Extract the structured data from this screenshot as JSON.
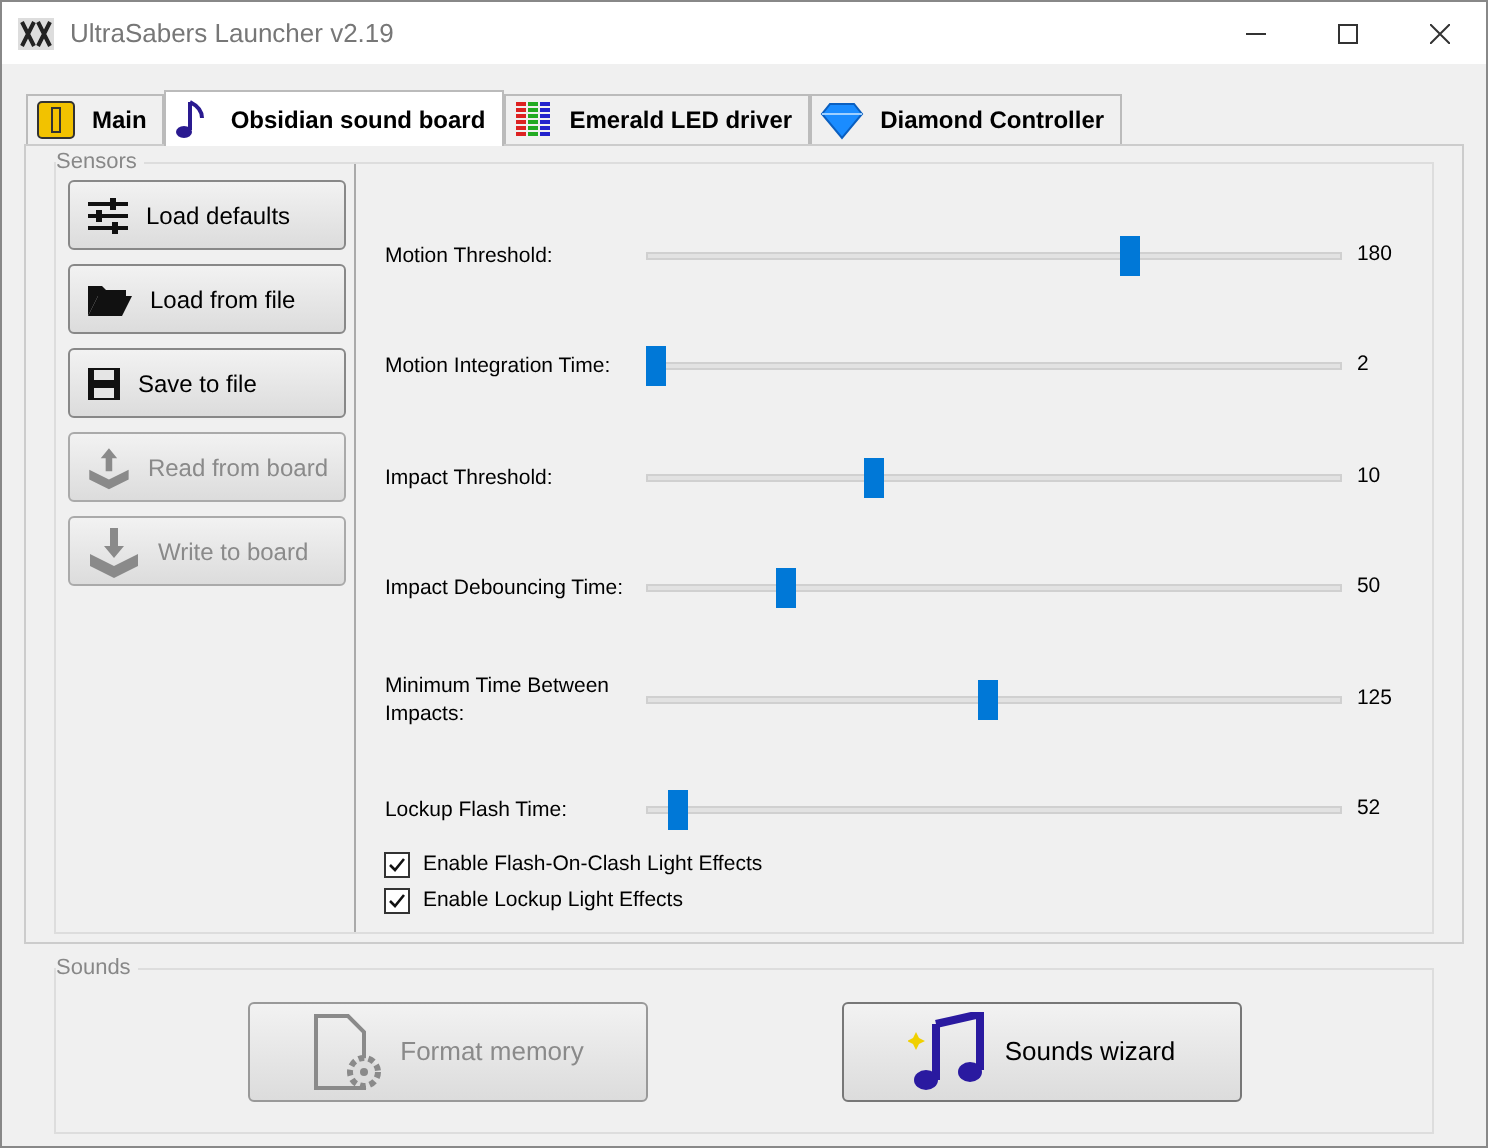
{
  "window": {
    "title": "UltraSabers Launcher v2.19"
  },
  "tabs": [
    {
      "label": "Main",
      "kind": "main",
      "selected": false
    },
    {
      "label": "Obsidian sound board",
      "kind": "sound",
      "selected": true
    },
    {
      "label": "Emerald LED driver",
      "kind": "led",
      "selected": false
    },
    {
      "label": "Diamond Controller",
      "kind": "diamond",
      "selected": false
    }
  ],
  "sensors": {
    "title": "Sensors",
    "buttons": [
      {
        "label": "Load defaults",
        "kind": "sliders",
        "disabled": false
      },
      {
        "label": "Load from file",
        "kind": "folder",
        "disabled": false
      },
      {
        "label": "Save to file",
        "kind": "save",
        "disabled": false
      },
      {
        "label": "Read from board",
        "kind": "upload",
        "disabled": true
      },
      {
        "label": "Write to board",
        "kind": "download",
        "disabled": true
      }
    ],
    "sliders": [
      {
        "label": "Motion Threshold:",
        "level": 0.7,
        "reading": "180"
      },
      {
        "label": "Motion Integration Time:",
        "level": 0,
        "reading": "2"
      },
      {
        "label": "Impact Threshold:",
        "level": 0.32,
        "reading": "10"
      },
      {
        "label": "Impact Debouncing Time:",
        "level": 0.19,
        "reading": "50"
      },
      {
        "label": "Minimum Time Between Impacts:",
        "level": 0.49,
        "reading": "125"
      },
      {
        "label": "Lockup Flash Time:",
        "level": 0.03,
        "reading": "52"
      }
    ],
    "checkboxes": [
      {
        "label": "Enable Flash-On-Clash Light Effects",
        "checked": true
      },
      {
        "label": "Enable Lockup Light Effects",
        "checked": true
      }
    ]
  },
  "sounds": {
    "title": "Sounds",
    "buttons": [
      {
        "label": "Format memory",
        "kind": "format",
        "disabled": true
      },
      {
        "label": "Sounds wizard",
        "kind": "wizard",
        "disabled": false
      }
    ]
  }
}
